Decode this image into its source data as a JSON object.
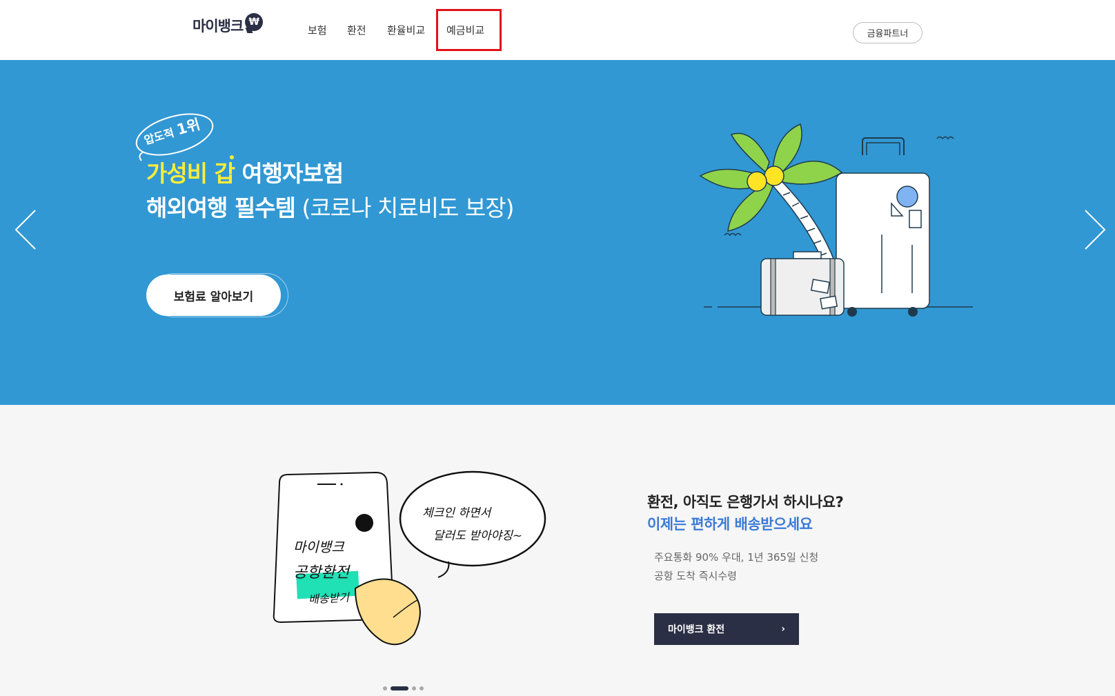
{
  "header": {
    "logo_text": "마이뱅크",
    "logo_badge": "₩",
    "nav": [
      {
        "label": "보험"
      },
      {
        "label": "환전"
      },
      {
        "label": "환율비교"
      },
      {
        "label": "예금비교"
      }
    ],
    "partner_button": "금융파트너"
  },
  "banner": {
    "badge_small": "압도적",
    "badge_big": "1위",
    "headline_line1_highlight": "가성비 갑",
    "headline_line1_rest": " 여행자보험",
    "headline_line2_bold": "해외여행 필수템",
    "headline_line2_light": " (코로나 치료비도 보장)",
    "cta_label": "보험료 알아보기",
    "colors": {
      "background": "#3198d3",
      "highlight": "#ffed3a"
    }
  },
  "promo": {
    "illustration": {
      "phone_line1": "마이뱅크",
      "phone_line2": "공항환전",
      "phone_button": "배송받기",
      "bubble_line1": "체크인 하면서",
      "bubble_line2": "달러도 받아야징~"
    },
    "title_line1": "환전, 아직도 은행가서 하시나요?",
    "title_line2": "이제는 편하게 배송받으세요",
    "desc_line1": "주요통화 90% 우대, 1년 365일 신청",
    "desc_line2": "공항 도착 즉시수령",
    "button_label": "마이뱅크 환전",
    "button_chevron": "›",
    "colors": {
      "accent": "#3a7ad6",
      "button": "#2b2f45"
    }
  },
  "pagination": {
    "count": 4,
    "active": 1
  }
}
